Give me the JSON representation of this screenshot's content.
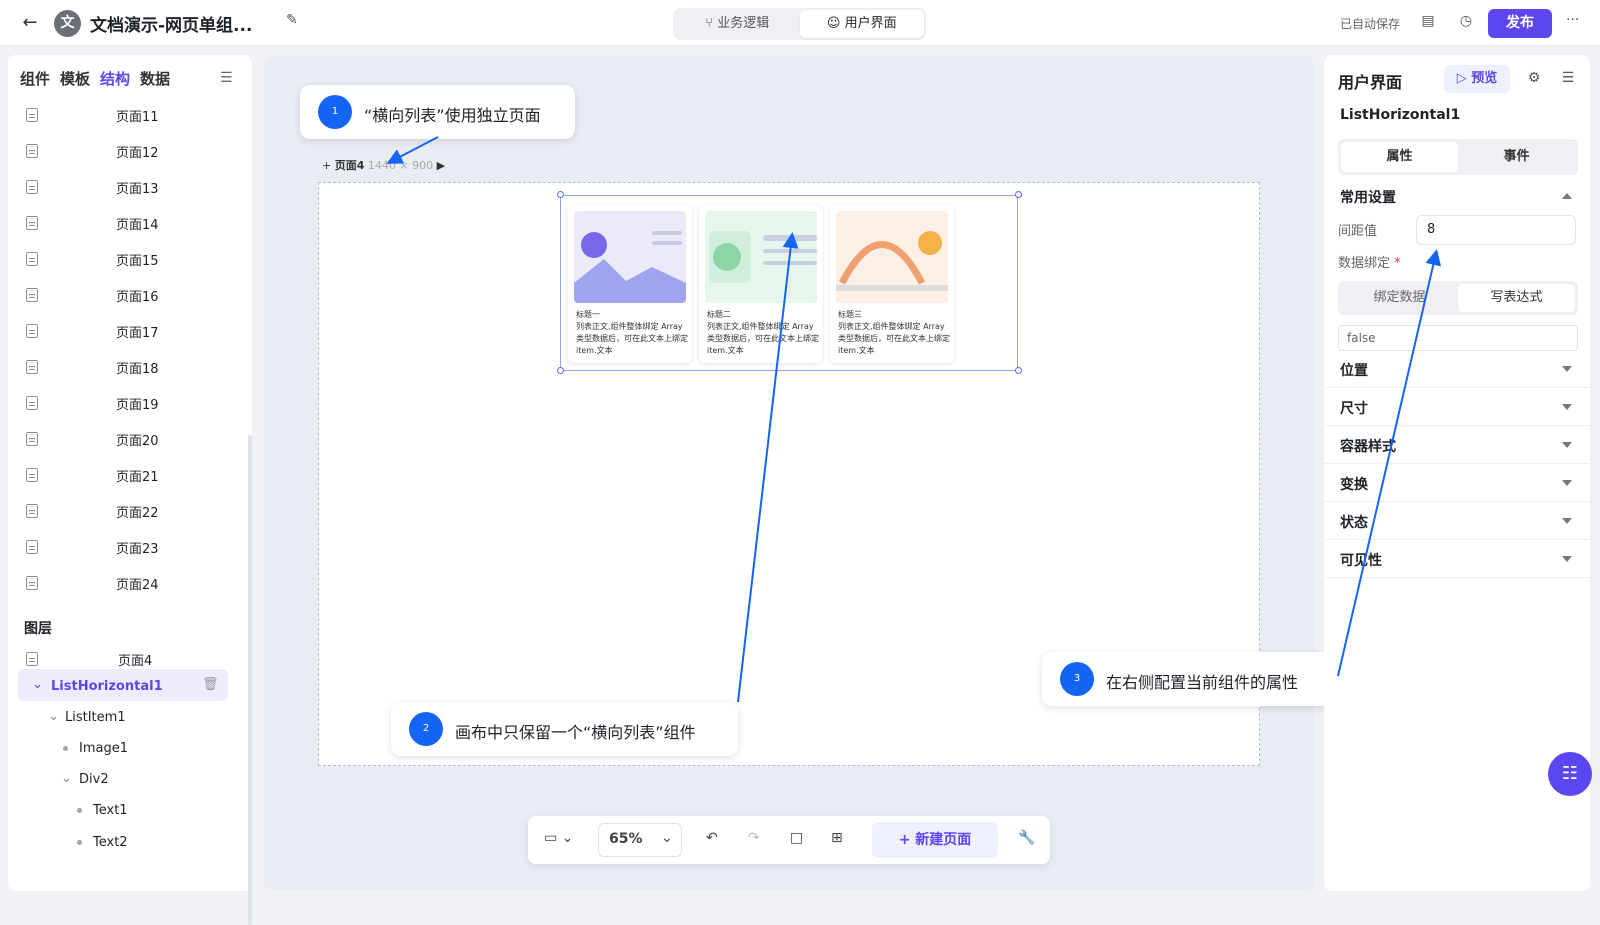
{
  "header": {
    "title": "文档演示-网页单组...",
    "logo_letter": "文",
    "tabs": [
      {
        "label": "业务逻辑"
      },
      {
        "label": "用户界面"
      }
    ],
    "autosave": "已自动保存",
    "publish": "发布"
  },
  "left": {
    "tabs": [
      "组件",
      "模板",
      "结构",
      "数据"
    ],
    "pages": [
      "页面11",
      "页面12",
      "页面13",
      "页面14",
      "页面15",
      "页面16",
      "页面17",
      "页面18",
      "页面19",
      "页面20",
      "页面21",
      "页面22",
      "页面23",
      "页面24"
    ],
    "layers_title": "图层",
    "layer_page": "页面4",
    "tree": {
      "root": "ListHorizontal1",
      "item": "ListItem1",
      "image": "Image1",
      "div": "Div2",
      "text1": "Text1",
      "text2": "Text2"
    }
  },
  "canvas": {
    "page_label": "页面4",
    "page_size": "1440 × 900",
    "cards": [
      {
        "title": "标题一",
        "body": "列表正文,组件整体绑定 Array 类型数据后，可在此文本上绑定 item.文本"
      },
      {
        "title": "标题二",
        "body": "列表正文,组件整体绑定 Array 类型数据后，可在此文本上绑定 item.文本"
      },
      {
        "title": "标题三",
        "body": "列表正文,组件整体绑定 Array 类型数据后，可在此文本上绑定 item.文本"
      }
    ]
  },
  "callouts": [
    {
      "num": "1",
      "text": "“横向列表”使用独立页面"
    },
    {
      "num": "2",
      "text": "画布中只保留一个“横向列表”组件"
    },
    {
      "num": "3",
      "text": "在右侧配置当前组件的属性"
    }
  ],
  "toolbar": {
    "zoom": "65%",
    "new_page": "新建页面"
  },
  "right": {
    "title": "用户界面",
    "preview": "预览",
    "component": "ListHorizontal1",
    "tabs": [
      "属性",
      "事件"
    ],
    "common": "常用设置",
    "spacing_label": "间距值",
    "spacing_value": "8",
    "binding_label": "数据绑定",
    "bind_tabs": [
      "绑定数据",
      "写表达式"
    ],
    "expr_value": "false",
    "sections": [
      "位置",
      "尺寸",
      "容器样式",
      "变换",
      "状态",
      "可见性"
    ]
  },
  "colors": {
    "accent": "#5b47f0",
    "callout": "#1565f5"
  }
}
